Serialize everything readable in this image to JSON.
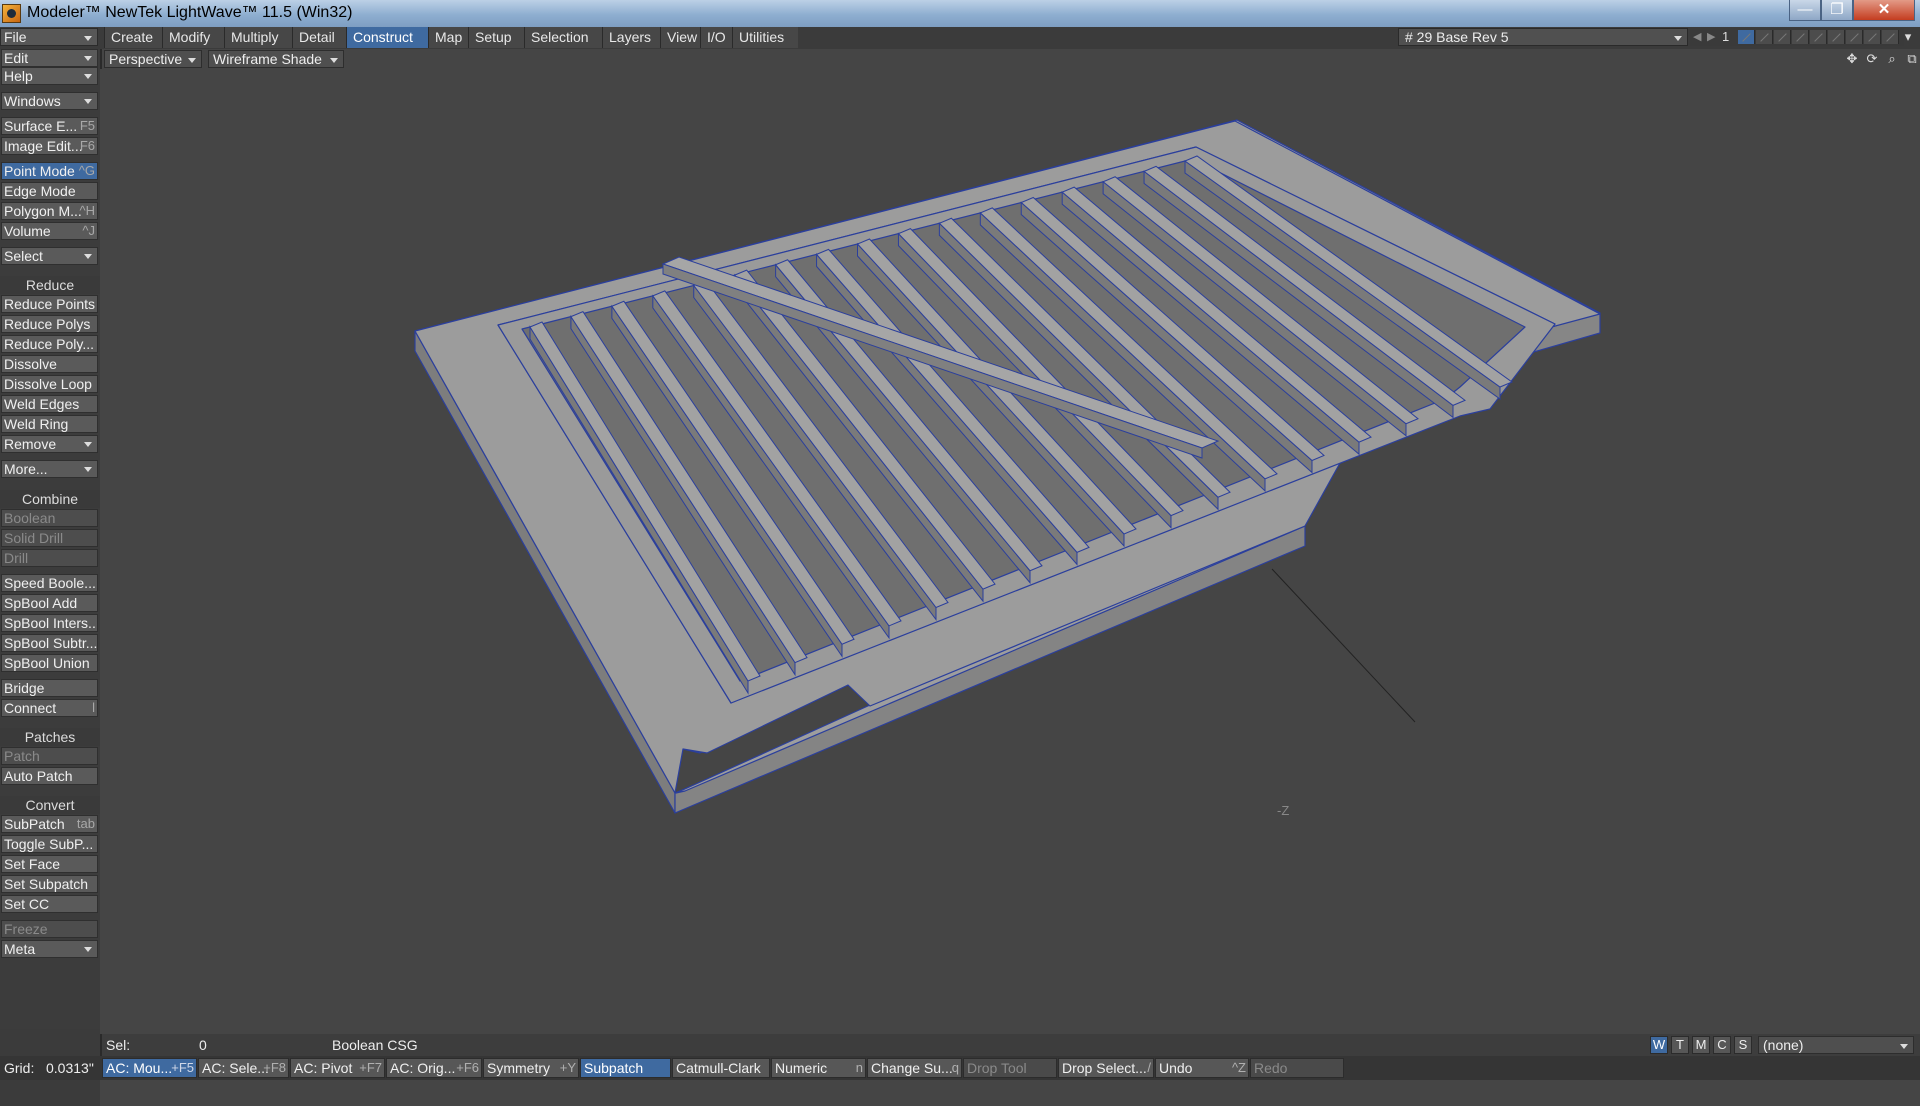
{
  "window": {
    "title": "Modeler™ NewTek LightWave™ 11.5 (Win32)",
    "minimize": "—",
    "maximize": "❐",
    "close": "✕"
  },
  "top_dropdowns": [
    "File",
    "Edit",
    "Help"
  ],
  "tabs": [
    "Create",
    "Modify",
    "Multiply",
    "Detail",
    "Construct",
    "Map",
    "Setup",
    "Selection",
    "Layers",
    "View",
    "I/O",
    "Utilities"
  ],
  "active_tab": "Construct",
  "layer": {
    "selected": "# 29 Base Rev 5",
    "number": "1"
  },
  "viewport": {
    "view": "Perspective",
    "shading": "Wireframe Shade",
    "axis_label": "-Z"
  },
  "toolbar": {
    "windows": "Windows",
    "surface_editor": {
      "label": "Surface E...",
      "shortcut": "F5"
    },
    "image_editor": {
      "label": "Image Edit...",
      "shortcut": "F6"
    },
    "point_mode": {
      "label": "Point Mode",
      "shortcut": "^G"
    },
    "edge_mode": {
      "label": "Edge Mode",
      "shortcut": ""
    },
    "polygon_mode": {
      "label": "Polygon M...",
      "shortcut": "^H"
    },
    "volume": {
      "label": "Volume",
      "shortcut": "^J"
    },
    "select": "Select",
    "reduce_header": "Reduce",
    "reduce_points": "Reduce Points",
    "reduce_polys": "Reduce Polys",
    "reduce_poly_more": "Reduce Poly...",
    "dissolve": "Dissolve",
    "dissolve_loop": "Dissolve Loop",
    "weld_edges": "Weld Edges",
    "weld_ring": "Weld Ring",
    "remove": "Remove",
    "more": "More...",
    "combine_header": "Combine",
    "boolean": "Boolean",
    "solid_drill": "Solid Drill",
    "drill": "Drill",
    "speed_boolean": "Speed Boole...",
    "spbool_add": "SpBool Add",
    "spbool_intersect": "SpBool Inters...",
    "spbool_subtract": "SpBool Subtr...",
    "spbool_union": "SpBool Union",
    "bridge": "Bridge",
    "connect": {
      "label": "Connect",
      "shortcut": "l"
    },
    "patches_header": "Patches",
    "patch": "Patch",
    "auto_patch": "Auto Patch",
    "convert_header": "Convert",
    "subpatch": {
      "label": "SubPatch",
      "shortcut": "tab"
    },
    "toggle_subpatch": "Toggle SubP...",
    "set_face": "Set Face",
    "set_subpatch": "Set Subpatch",
    "set_cc": "Set CC",
    "freeze": "Freeze",
    "meta": "Meta"
  },
  "infobar": {
    "sel_label": "Sel:",
    "sel_count": "0",
    "tool": "Boolean CSG",
    "modes": [
      "W",
      "T",
      "M",
      "C",
      "S"
    ],
    "active_mode": "W",
    "surface": "(none)"
  },
  "bottombar": {
    "grid_label": "Grid:",
    "grid_value": "0.0313\"",
    "buttons": [
      {
        "label": "AC: Mou...",
        "shortcut": "+F5",
        "state": "active"
      },
      {
        "label": "AC: Sele...",
        "shortcut": "+F8",
        "state": "normal"
      },
      {
        "label": "AC: Pivot",
        "shortcut": "+F7",
        "state": "normal"
      },
      {
        "label": "AC: Orig...",
        "shortcut": "+F6",
        "state": "normal"
      },
      {
        "label": "Symmetry",
        "shortcut": "+Y",
        "state": "normal"
      },
      {
        "label": "Subpatch",
        "shortcut": "",
        "state": "active"
      },
      {
        "label": "Catmull-Clark",
        "shortcut": "",
        "state": "normal"
      },
      {
        "label": "Numeric",
        "shortcut": "n",
        "state": "normal"
      },
      {
        "label": "Change Su...",
        "shortcut": "q",
        "state": "normal"
      },
      {
        "label": "Drop Tool",
        "shortcut": "",
        "state": "disabled"
      },
      {
        "label": "Drop Select...",
        "shortcut": "/",
        "state": "normal"
      },
      {
        "label": "Undo",
        "shortcut": "^Z",
        "state": "normal"
      },
      {
        "label": "Redo",
        "shortcut": "",
        "state": "disabled"
      }
    ]
  },
  "colors": {
    "accent": "#3f6aa0",
    "background": "#454545",
    "model_top": "#9c9c9c",
    "model_side": "#828282",
    "model_edge": "#2a3f9a"
  }
}
